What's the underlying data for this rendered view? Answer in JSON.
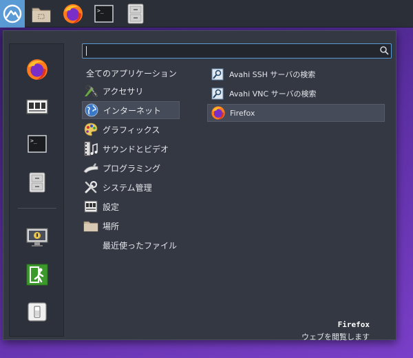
{
  "taskbar": {
    "items": [
      {
        "name": "menu-logo",
        "icon": "mountain-logo-icon"
      },
      {
        "name": "file-manager",
        "icon": "folder-icon"
      },
      {
        "name": "firefox",
        "icon": "firefox-icon"
      },
      {
        "name": "terminal",
        "icon": "terminal-icon"
      },
      {
        "name": "archive",
        "icon": "file-cabinet-icon"
      }
    ]
  },
  "search": {
    "value": ""
  },
  "favorites": [
    {
      "icon": "firefox-icon"
    },
    {
      "icon": "settings-panel-icon"
    },
    {
      "icon": "terminal-icon"
    },
    {
      "icon": "file-cabinet-icon"
    },
    {
      "icon": "lock-screen-icon"
    },
    {
      "icon": "logout-icon"
    },
    {
      "icon": "shutdown-icon"
    }
  ],
  "categories": [
    {
      "label": "全てのアプリケーション",
      "icon": ""
    },
    {
      "label": "アクセサリ",
      "icon": "accessories-icon"
    },
    {
      "label": "インターネット",
      "icon": "globe-icon",
      "selected": true
    },
    {
      "label": "グラフィックス",
      "icon": "graphics-palette-icon"
    },
    {
      "label": "サウンドとビデオ",
      "icon": "multimedia-icon"
    },
    {
      "label": "プログラミング",
      "icon": "programming-icon"
    },
    {
      "label": "システム管理",
      "icon": "system-tools-icon"
    },
    {
      "label": "設定",
      "icon": "settings-icon"
    },
    {
      "label": "場所",
      "icon": "folder-icon"
    },
    {
      "label": "最近使ったファイル",
      "icon": ""
    }
  ],
  "apps": [
    {
      "label": "Avahi SSH サーバの検索",
      "icon": "avahi-search-icon"
    },
    {
      "label": "Avahi VNC サーバの検索",
      "icon": "avahi-search-icon"
    },
    {
      "label": "Firefox",
      "icon": "firefox-icon",
      "selected": true
    }
  ],
  "description": {
    "title": "Firefox",
    "text": "ウェブを閲覧します"
  },
  "colors": {
    "accent": "#5b9bd5",
    "panel_bg": "#343843",
    "selected_bg": "#454b58"
  }
}
